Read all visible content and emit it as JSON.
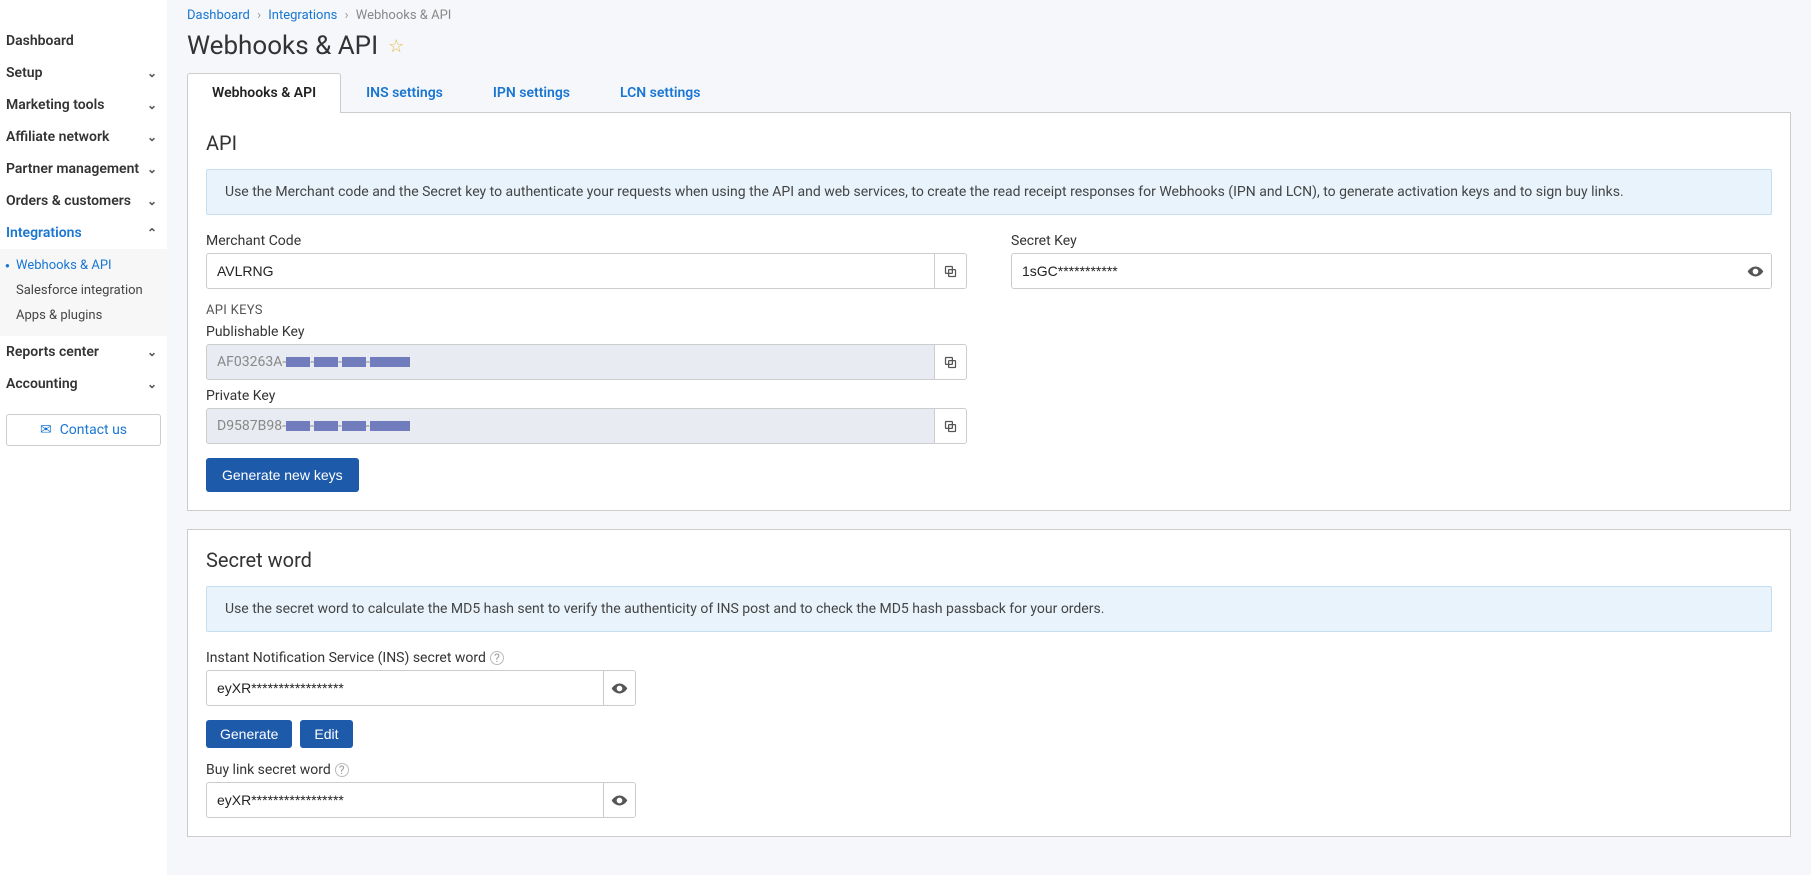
{
  "breadcrumb": {
    "dashboard": "Dashboard",
    "integrations": "Integrations",
    "current": "Webhooks & API"
  },
  "page_title": "Webhooks & API",
  "sidebar": {
    "dashboard": "Dashboard",
    "setup": "Setup",
    "marketing": "Marketing tools",
    "affiliate": "Affiliate network",
    "partner": "Partner management",
    "orders": "Orders & customers",
    "integrations": "Integrations",
    "sub_webhooks": "Webhooks & API",
    "sub_salesforce": "Salesforce integration",
    "sub_apps": "Apps & plugins",
    "reports": "Reports center",
    "accounting": "Accounting",
    "contact": "Contact us"
  },
  "tabs": {
    "webhooks": "Webhooks & API",
    "ins": "INS settings",
    "ipn": "IPN settings",
    "lcn": "LCN settings"
  },
  "api": {
    "heading": "API",
    "info": "Use the Merchant code and the Secret key to authenticate your requests when using the API and web services, to create the read receipt responses for Webhooks (IPN and LCN), to generate activation keys and to sign buy links.",
    "merchant_label": "Merchant Code",
    "merchant_value": "AVLRNG",
    "secret_label": "Secret Key",
    "secret_value": "1sGC***********",
    "apikeys_heading": "API KEYS",
    "publishable_label": "Publishable Key",
    "publishable_prefix": "AF03263A-",
    "private_label": "Private Key",
    "private_prefix": "D9587B98-",
    "generate_btn": "Generate new keys"
  },
  "secret_word": {
    "heading": "Secret word",
    "info": "Use the secret word to calculate the MD5 hash sent to verify the authenticity of INS post and to check the MD5 hash passback for your orders.",
    "ins_label": "Instant Notification Service (INS) secret word",
    "ins_value": "eyXR*****************",
    "buy_label": "Buy link secret word",
    "buy_value": "eyXR*****************",
    "generate_btn": "Generate",
    "edit_btn": "Edit"
  }
}
